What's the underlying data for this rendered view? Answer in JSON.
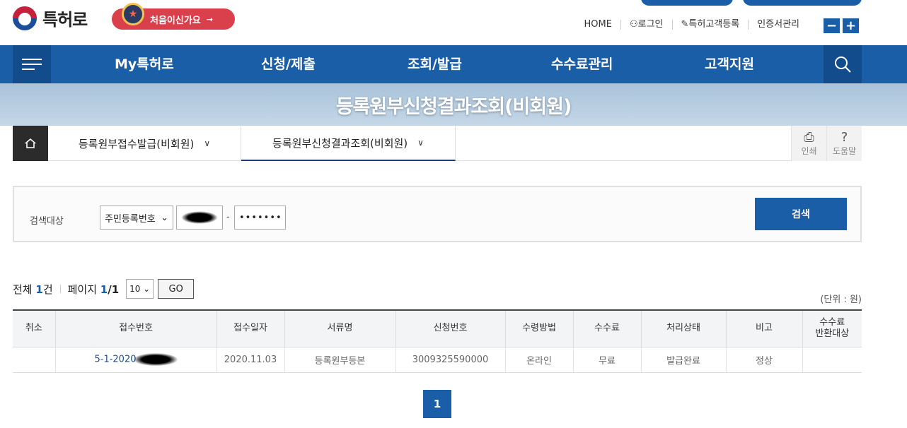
{
  "header": {
    "logo_text": "특허로",
    "first_visit_label": "처음이신가요",
    "util_links": [
      "HOME",
      "로그인",
      "특허고객등록",
      "인증서관리"
    ],
    "zoom_out": "−",
    "zoom_in": "+"
  },
  "nav": {
    "items": [
      "My특허로",
      "신청/제출",
      "조회/발급",
      "수수료관리",
      "고객지원"
    ]
  },
  "banner": {
    "title": "등록원부신청결과조회(비회원)"
  },
  "subnav": {
    "tabs": [
      "등록원부접수발급(비회원)",
      "등록원부신청결과조회(비회원)"
    ],
    "print_label": "인쇄",
    "help_label": "도움말"
  },
  "search": {
    "label": "검색대상",
    "type_selected": "주민등록번호",
    "field2_value": "•••••••",
    "button_label": "검색"
  },
  "results": {
    "total_prefix": "전체 ",
    "total_count": "1",
    "total_suffix": "건",
    "page_prefix": "페이지 ",
    "page_current": "1",
    "page_total": "/1",
    "page_size": "10",
    "go_label": "GO",
    "unit": "(단위 : 원)"
  },
  "table": {
    "headers": [
      "취소",
      "접수번호",
      "접수일자",
      "서류명",
      "신청번호",
      "수령방법",
      "수수료",
      "처리상태",
      "비고",
      "수수료\n반환대상"
    ],
    "rows": [
      {
        "cancel": "",
        "receipt_no": "5-1-2020",
        "date": "2020.11.03",
        "doc": "등록원부등본",
        "app_no": "3009325590000",
        "method": "온라인",
        "fee": "무료",
        "status": "발급완료",
        "note": "정상",
        "refund": ""
      }
    ]
  },
  "pagination": {
    "current": "1"
  },
  "colors": {
    "primary": "#1a5ea8",
    "accent_red": "#d9404c"
  }
}
